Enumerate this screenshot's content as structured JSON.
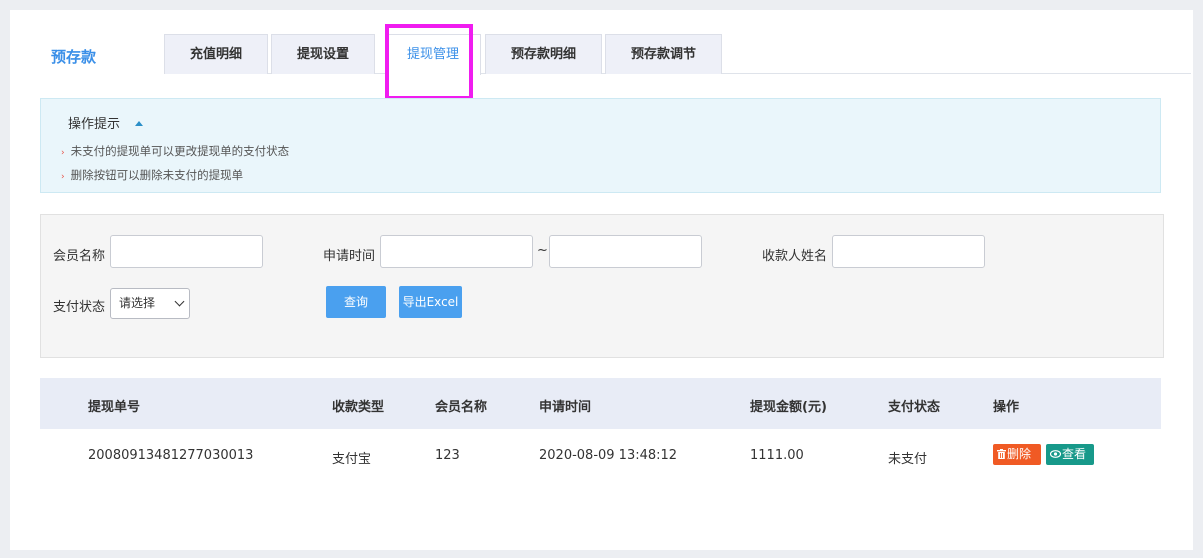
{
  "section_title": "预存款",
  "tabs": [
    {
      "label": "充值明细"
    },
    {
      "label": "提现设置"
    },
    {
      "label": "提现管理"
    },
    {
      "label": "预存款明细"
    },
    {
      "label": "预存款调节"
    }
  ],
  "tips": {
    "title": "操作提示",
    "items": [
      "未支付的提现单可以更改提现单的支付状态",
      "删除按钮可以删除未支付的提现单"
    ]
  },
  "filters": {
    "member_name_label": "会员名称",
    "apply_time_label": "申请时间",
    "range_sep": "~",
    "payee_name_label": "收款人姓名",
    "pay_status_label": "支付状态",
    "pay_status_value": "请选择",
    "query_button": "查询",
    "export_button": "导出Excel"
  },
  "table": {
    "headers": [
      "提现单号",
      "收款类型",
      "会员名称",
      "申请时间",
      "提现金额(元)",
      "支付状态",
      "操作"
    ],
    "rows": [
      {
        "order_no": "20080913481277030013",
        "pay_type": "支付宝",
        "member": "123",
        "apply_time": "2020-08-09 13:48:12",
        "amount": "1111.00",
        "status": "未支付",
        "delete_label": "删除",
        "view_label": "查看"
      }
    ]
  },
  "colors": {
    "accent": "#3a8fe8",
    "delete_button": "#f05a24",
    "view_button": "#17998a",
    "highlight_box": "#f01cf0"
  }
}
